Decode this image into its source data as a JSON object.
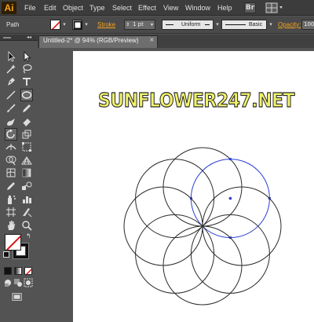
{
  "menubar": {
    "app_logo": "Ai",
    "items": [
      "File",
      "Edit",
      "Object",
      "Type",
      "Select",
      "Effect",
      "View",
      "Window",
      "Help"
    ],
    "bridge_label": "Br"
  },
  "controlbar": {
    "selection_type": "Path",
    "stroke_label": "Stroke",
    "stroke_weight": "1 pt",
    "variable_width_profile": "Uniform",
    "brush_definition": "Basic",
    "opacity_label": "Opacity",
    "opacity_value": "100%"
  },
  "document": {
    "tab_title": "Untitled-2* @ 94% (RGB/Preview)",
    "close_glyph": "×",
    "watermark": "SUNFLOWER247.NET"
  },
  "toolbox": {
    "collapse_glyph": "◂◂",
    "swap_glyph": "↰",
    "tools": [
      "selection-tool",
      "direct-selection-tool",
      "magic-wand-tool",
      "lasso-tool",
      "pen-tool",
      "type-tool",
      "line-segment-tool",
      "ellipse-tool",
      "paintbrush-tool",
      "pencil-tool",
      "blob-brush-tool",
      "eraser-tool",
      "rotate-tool",
      "scale-tool",
      "width-tool",
      "free-transform-tool",
      "shape-builder-tool",
      "perspective-grid-tool",
      "mesh-tool",
      "gradient-tool",
      "eyedropper-tool",
      "blend-tool",
      "symbol-sprayer-tool",
      "column-graph-tool",
      "artboard-tool",
      "slice-tool",
      "hand-tool",
      "zoom-tool"
    ],
    "active_tool": "ellipse-tool"
  },
  "artwork": {
    "selection_color": "#2b3fd6",
    "stroke_color": "#2a2a2a",
    "circle_count": 8,
    "selected_circle_index": 1
  },
  "colors": {
    "app_accent": "#f7a21b",
    "watermark_fill": "#f1f36a"
  }
}
